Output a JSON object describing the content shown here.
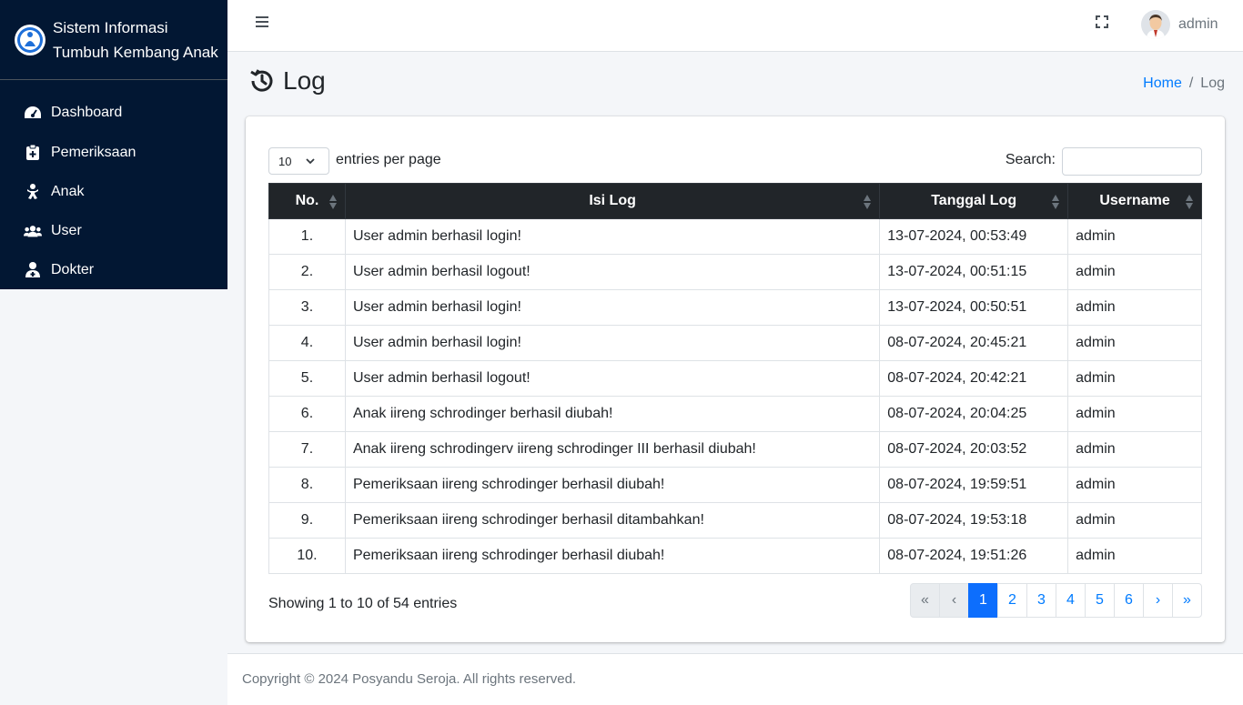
{
  "sidebar": {
    "brand_line1": "Sistem Informasi",
    "brand_line2": "Tumbuh Kembang Anak",
    "items": [
      {
        "label": "Dashboard",
        "icon": "tachometer-icon"
      },
      {
        "label": "Pemeriksaan",
        "icon": "clipboard-medical-icon"
      },
      {
        "label": "Anak",
        "icon": "child-icon"
      },
      {
        "label": "User",
        "icon": "users-icon"
      },
      {
        "label": "Dokter",
        "icon": "doctor-icon"
      }
    ]
  },
  "topbar": {
    "user_name": "admin"
  },
  "page": {
    "title": "Log",
    "breadcrumb_home": "Home",
    "breadcrumb_sep": "/",
    "breadcrumb_current": "Log"
  },
  "datatable": {
    "length_value": "10",
    "length_label": "entries per page",
    "search_label": "Search:",
    "search_value": "",
    "columns": [
      "No.",
      "Isi Log",
      "Tanggal Log",
      "Username"
    ],
    "rows": [
      {
        "no": "1.",
        "isi": "User admin berhasil login!",
        "tanggal": "13-07-2024, 00:53:49",
        "username": "admin"
      },
      {
        "no": "2.",
        "isi": "User admin berhasil logout!",
        "tanggal": "13-07-2024, 00:51:15",
        "username": "admin"
      },
      {
        "no": "3.",
        "isi": "User admin berhasil login!",
        "tanggal": "13-07-2024, 00:50:51",
        "username": "admin"
      },
      {
        "no": "4.",
        "isi": "User admin berhasil login!",
        "tanggal": "08-07-2024, 20:45:21",
        "username": "admin"
      },
      {
        "no": "5.",
        "isi": "User admin berhasil logout!",
        "tanggal": "08-07-2024, 20:42:21",
        "username": "admin"
      },
      {
        "no": "6.",
        "isi": "Anak iireng schrodinger berhasil diubah!",
        "tanggal": "08-07-2024, 20:04:25",
        "username": "admin"
      },
      {
        "no": "7.",
        "isi": "Anak iireng schrodingerv iireng schrodinger III berhasil diubah!",
        "tanggal": "08-07-2024, 20:03:52",
        "username": "admin"
      },
      {
        "no": "8.",
        "isi": "Pemeriksaan iireng schrodinger berhasil diubah!",
        "tanggal": "08-07-2024, 19:59:51",
        "username": "admin"
      },
      {
        "no": "9.",
        "isi": "Pemeriksaan iireng schrodinger berhasil ditambahkan!",
        "tanggal": "08-07-2024, 19:53:18",
        "username": "admin"
      },
      {
        "no": "10.",
        "isi": "Pemeriksaan iireng schrodinger berhasil diubah!",
        "tanggal": "08-07-2024, 19:51:26",
        "username": "admin"
      }
    ],
    "info": "Showing 1 to 10 of 54 entries",
    "pagination": {
      "first": "«",
      "prev": "‹",
      "pages": [
        "1",
        "2",
        "3",
        "4",
        "5",
        "6"
      ],
      "current": "1",
      "next": "›",
      "last": "»"
    }
  },
  "footer": {
    "text": "Copyright © 2024 Posyandu Seroja. All rights reserved."
  },
  "colors": {
    "sidebar_bg": "#021733",
    "accent": "#0d6efd",
    "table_header_bg": "#212529"
  }
}
